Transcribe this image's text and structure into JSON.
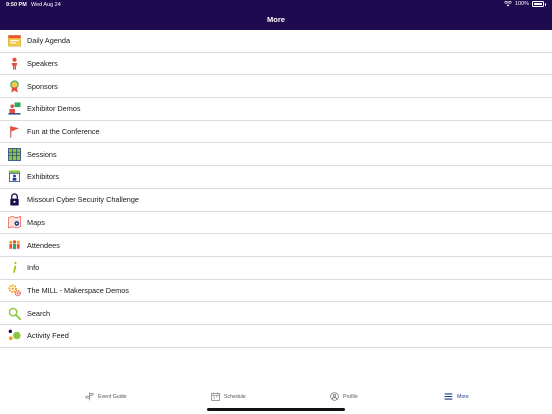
{
  "status_bar": {
    "time": "9:50 PM",
    "date": "Wed Aug 24",
    "battery": "100%"
  },
  "header": {
    "title": "More"
  },
  "menu": {
    "items": [
      {
        "label": "Daily Agenda",
        "icon": "calendar-agenda-icon"
      },
      {
        "label": "Speakers",
        "icon": "speaker-person-icon"
      },
      {
        "label": "Sponsors",
        "icon": "ribbon-award-icon"
      },
      {
        "label": "Exhibitor Demos",
        "icon": "demo-presenter-icon"
      },
      {
        "label": "Fun at the Conference",
        "icon": "red-flag-icon"
      },
      {
        "label": "Sessions",
        "icon": "sessions-grid-icon"
      },
      {
        "label": "Exhibitors",
        "icon": "exhibitor-booth-icon"
      },
      {
        "label": "Missouri Cyber Security Challenge",
        "icon": "padlock-icon"
      },
      {
        "label": "Maps",
        "icon": "map-pin-icon"
      },
      {
        "label": "Attendees",
        "icon": "attendees-group-icon"
      },
      {
        "label": "Info",
        "icon": "info-icon"
      },
      {
        "label": "The MILL - Makerspace Demos",
        "icon": "gears-icon"
      },
      {
        "label": "Search",
        "icon": "search-icon"
      },
      {
        "label": "Activity Feed",
        "icon": "activity-feed-icon"
      }
    ]
  },
  "tabbar": {
    "tabs": [
      {
        "label": "Event Guide",
        "icon": "event-guide-icon"
      },
      {
        "label": "Schedule",
        "icon": "calendar-icon"
      },
      {
        "label": "Profile",
        "icon": "profile-icon"
      },
      {
        "label": "More",
        "icon": "hamburger-menu-icon",
        "active": true
      }
    ]
  },
  "colors": {
    "header_bg": "#1e0a4e",
    "active_tab": "#1e3a8a"
  }
}
